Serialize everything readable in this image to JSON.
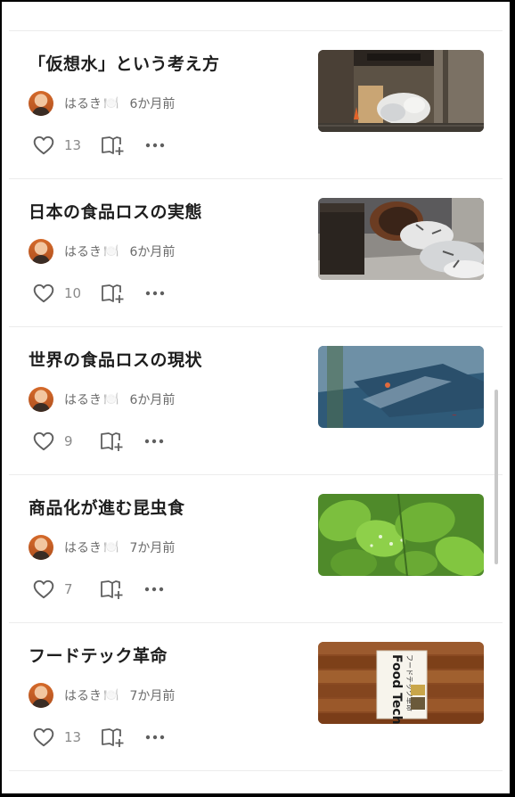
{
  "articles": [
    {
      "title": "「仮想水」という考え方",
      "author": "はるき",
      "author_emoji": "🍽️",
      "date": "6か月前",
      "likes": "13",
      "thumbnail": "garbage-bags-in-alley"
    },
    {
      "title": "日本の食品ロスの実態",
      "author": "はるき",
      "author_emoji": "🍽️",
      "date": "6か月前",
      "likes": "10",
      "thumbnail": "trash-spilling-from-drum"
    },
    {
      "title": "世界の食品ロスの現状",
      "author": "はるき",
      "author_emoji": "🍽️",
      "date": "6か月前",
      "likes": "9",
      "thumbnail": "pavement-with-shadows"
    },
    {
      "title": "商品化が進む昆虫食",
      "author": "はるき",
      "author_emoji": "🍽️",
      "date": "7か月前",
      "likes": "7",
      "thumbnail": "green-leaves-with-dew"
    },
    {
      "title": "フードテック革命",
      "author": "はるき",
      "author_emoji": "🍽️",
      "date": "7か月前",
      "likes": "13",
      "thumbnail": "food-tech-book-on-wood",
      "thumbnail_text": [
        "Food Tech",
        "フードテック革命"
      ]
    }
  ],
  "icons": {
    "like": "heart-icon",
    "magazine": "add-to-magazine-icon",
    "more": "more-dots-icon"
  },
  "colors": {
    "title": "#1e1e1e",
    "meta": "#6b6b6b",
    "icon": "#5f5f5f",
    "separator": "#ececec"
  }
}
